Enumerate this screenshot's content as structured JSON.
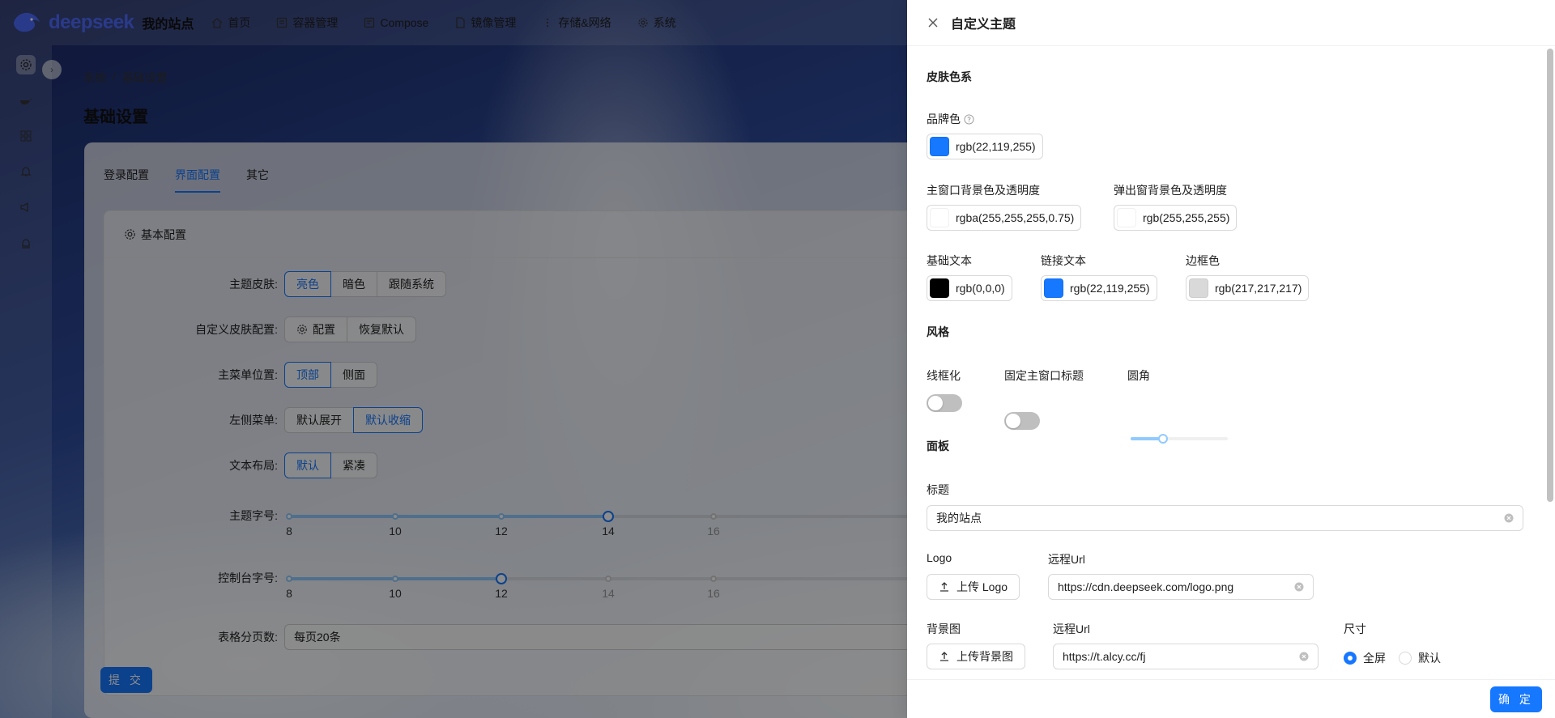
{
  "app": {
    "logo_text": "deepseek",
    "site_name": "我的站点"
  },
  "nav": {
    "items": [
      {
        "label": "首页",
        "icon": "home-icon"
      },
      {
        "label": "容器管理",
        "icon": "container-icon"
      },
      {
        "label": "Compose",
        "icon": "compose-icon"
      },
      {
        "label": "镜像管理",
        "icon": "image-icon"
      },
      {
        "label": "存储&网络",
        "icon": "storage-icon"
      },
      {
        "label": "系统",
        "icon": "gear-icon"
      }
    ]
  },
  "sidebar": {
    "icons": [
      "gear-icon",
      "docker-icon",
      "grid-icon",
      "bell-icon",
      "speaker-icon",
      "alert-icon"
    ]
  },
  "breadcrumb": {
    "items": [
      "系统",
      "基础设置"
    ],
    "separator": "/"
  },
  "page": {
    "title": "基础设置"
  },
  "tabs": [
    {
      "label": "登录配置",
      "active": false
    },
    {
      "label": "界面配置",
      "active": true
    },
    {
      "label": "其它",
      "active": false
    }
  ],
  "basic_config": {
    "title": "基本配置",
    "theme_skin": {
      "label": "主题皮肤:",
      "options": [
        "亮色",
        "暗色",
        "跟随系统"
      ],
      "selected": "亮色"
    },
    "custom_skin": {
      "label": "自定义皮肤配置:",
      "config_label": "配置",
      "reset_label": "恢复默认"
    },
    "menu_position": {
      "label": "主菜单位置:",
      "options": [
        "顶部",
        "侧面"
      ],
      "selected": "顶部"
    },
    "left_menu": {
      "label": "左侧菜单:",
      "options": [
        "默认展开",
        "默认收缩"
      ],
      "selected": "默认收缩"
    },
    "text_layout": {
      "label": "文本布局:",
      "options": [
        "默认",
        "紧凑"
      ],
      "selected": "默认"
    },
    "theme_font_size": {
      "label": "主题字号:",
      "marks": [
        "8",
        "10",
        "12",
        "14",
        "16"
      ],
      "value": "14"
    },
    "console_font_size": {
      "label": "控制台字号:",
      "marks": [
        "8",
        "10",
        "12",
        "14",
        "16"
      ],
      "value": "12"
    },
    "table_page_size": {
      "label": "表格分页数:",
      "value": "每页20条"
    },
    "submit_label": "提 交"
  },
  "drawer": {
    "title": "自定义主题",
    "skin_colors": {
      "section": "皮肤色系",
      "brand": {
        "label": "品牌色",
        "value": "rgb(22,119,255)",
        "color": "#1677ff"
      },
      "main_bg": {
        "label": "主窗口背景色及透明度",
        "value": "rgba(255,255,255,0.75)",
        "color": "#ffffff"
      },
      "popup_bg": {
        "label": "弹出窗背景色及透明度",
        "value": "rgb(255,255,255)",
        "color": "#ffffff"
      },
      "base_text": {
        "label": "基础文本",
        "value": "rgb(0,0,0)",
        "color": "#000000"
      },
      "link_text": {
        "label": "链接文本",
        "value": "rgb(22,119,255)",
        "color": "#1677ff"
      },
      "border": {
        "label": "边框色",
        "value": "rgb(217,217,217)",
        "color": "#d9d9d9"
      }
    },
    "style": {
      "section": "风格",
      "wireframe": {
        "label": "线框化",
        "on": false
      },
      "fixed_title": {
        "label": "固定主窗口标题",
        "on": false
      },
      "radius": {
        "label": "圆角",
        "fraction": 0.33
      }
    },
    "panel": {
      "section": "面板",
      "title": {
        "label": "标题",
        "value": "我的站点"
      },
      "logo": {
        "label": "Logo",
        "upload_label": "上传 Logo",
        "remote_label": "远程Url",
        "remote_value": "https://cdn.deepseek.com/logo.png"
      },
      "background": {
        "label": "背景图",
        "upload_label": "上传背景图",
        "remote_label": "远程Url",
        "remote_value": "https://t.alcy.cc/fj",
        "size_label": "尺寸",
        "size_options": [
          "全屏",
          "默认"
        ],
        "size_selected": "全屏"
      }
    },
    "ok_label": "确 定"
  }
}
